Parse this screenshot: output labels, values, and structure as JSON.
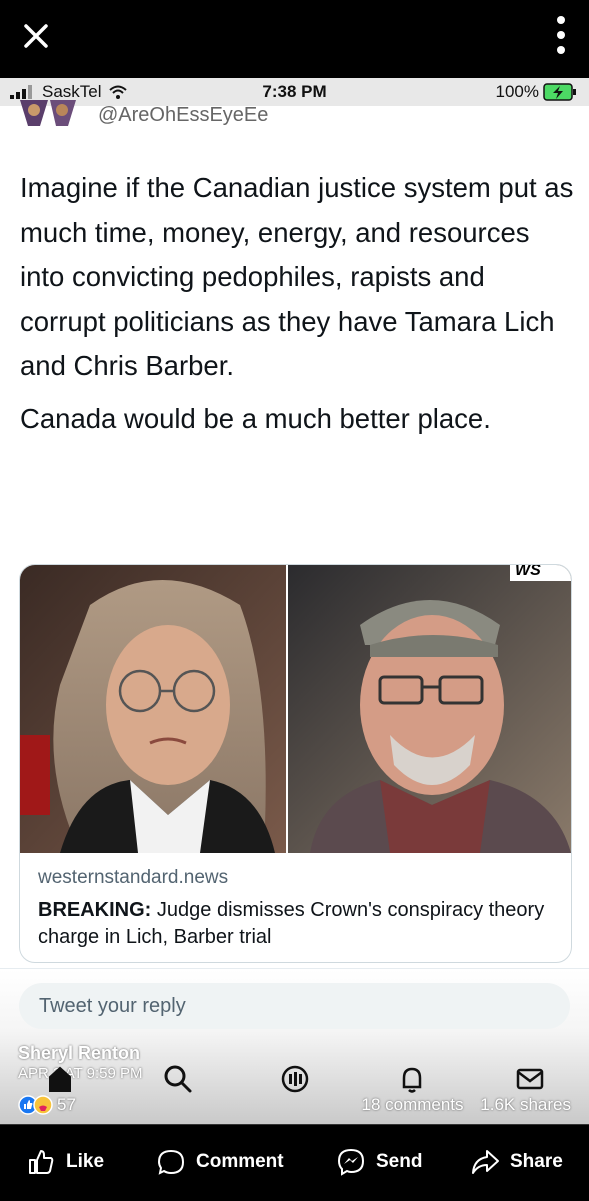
{
  "status_bar": {
    "carrier": "SaskTel",
    "time": "7:38 PM",
    "battery": "100%"
  },
  "tweet": {
    "handle": "@AreOhEssEyeEe",
    "paragraphs": [
      "Imagine if the Canadian justice system put as much time, money, energy, and resources into convicting pedophiles, rapists and corrupt politicians as they have Tamara Lich and Chris Barber.",
      "Canada would be a much better place."
    ]
  },
  "link_card": {
    "badge": "WS",
    "domain": "westernstandard.news",
    "headline_bold": "BREAKING:",
    "headline_rest": " Judge dismisses Crown's conspiracy theory charge in Lich, Barber trial"
  },
  "reply": {
    "placeholder": "Tweet your reply"
  },
  "post": {
    "poster": "Sheryl Renton",
    "date": "APR 3 AT 9:59 PM",
    "reaction_count": "57",
    "comments": "18 comments",
    "shares": "1.6K shares"
  },
  "actions": {
    "like": "Like",
    "comment": "Comment",
    "send": "Send",
    "share": "Share"
  }
}
